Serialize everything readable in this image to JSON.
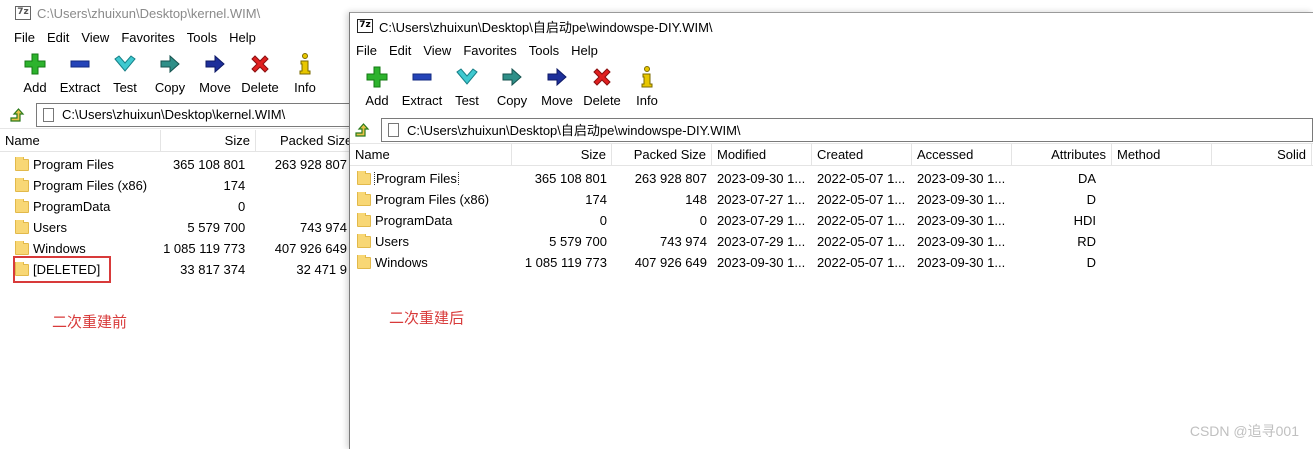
{
  "left_window": {
    "title": "C:\\Users\\zhuixun\\Desktop\\kernel.WIM\\",
    "menu": [
      "File",
      "Edit",
      "View",
      "Favorites",
      "Tools",
      "Help"
    ],
    "toolbar": {
      "add": "Add",
      "extract": "Extract",
      "test": "Test",
      "copy": "Copy",
      "move": "Move",
      "delete": "Delete",
      "info": "Info"
    },
    "address": "C:\\Users\\zhuixun\\Desktop\\kernel.WIM\\",
    "columns": {
      "name": "Name",
      "size": "Size",
      "packed_size": "Packed Size"
    },
    "rows": [
      {
        "name": "Program Files",
        "size": "365 108 801",
        "packed": "263 928 807"
      },
      {
        "name": "Program Files (x86)",
        "size": "174",
        "packed": ""
      },
      {
        "name": "ProgramData",
        "size": "0",
        "packed": ""
      },
      {
        "name": "Users",
        "size": "5 579 700",
        "packed": "743 974"
      },
      {
        "name": "Windows",
        "size": "1 085 119 773",
        "packed": "407 926 649"
      },
      {
        "name": "[DELETED]",
        "size": "33 817 374",
        "packed": "32 471 9"
      }
    ],
    "annotation": "二次重建前"
  },
  "right_window": {
    "title": "C:\\Users\\zhuixun\\Desktop\\自启动pe\\windowspe-DIY.WIM\\",
    "menu": [
      "File",
      "Edit",
      "View",
      "Favorites",
      "Tools",
      "Help"
    ],
    "toolbar": {
      "add": "Add",
      "extract": "Extract",
      "test": "Test",
      "copy": "Copy",
      "move": "Move",
      "delete": "Delete",
      "info": "Info"
    },
    "address": "C:\\Users\\zhuixun\\Desktop\\自启动pe\\windowspe-DIY.WIM\\",
    "columns": {
      "name": "Name",
      "size": "Size",
      "packed_size": "Packed Size",
      "modified": "Modified",
      "created": "Created",
      "accessed": "Accessed",
      "attributes": "Attributes",
      "method": "Method",
      "solid": "Solid"
    },
    "rows": [
      {
        "name": "Program Files",
        "size": "365 108 801",
        "packed": "263 928 807",
        "modified": "2023-09-30 1...",
        "created": "2022-05-07 1...",
        "accessed": "2023-09-30 1...",
        "attributes": "DA"
      },
      {
        "name": "Program Files (x86)",
        "size": "174",
        "packed": "148",
        "modified": "2023-07-27 1...",
        "created": "2022-05-07 1...",
        "accessed": "2023-09-30 1...",
        "attributes": "D"
      },
      {
        "name": "ProgramData",
        "size": "0",
        "packed": "0",
        "modified": "2023-07-29 1...",
        "created": "2022-05-07 1...",
        "accessed": "2023-09-30 1...",
        "attributes": "HDI"
      },
      {
        "name": "Users",
        "size": "5 579 700",
        "packed": "743 974",
        "modified": "2023-07-29 1...",
        "created": "2022-05-07 1...",
        "accessed": "2023-09-30 1...",
        "attributes": "RD"
      },
      {
        "name": "Windows",
        "size": "1 085 119 773",
        "packed": "407 926 649",
        "modified": "2023-09-30 1...",
        "created": "2022-05-07 1...",
        "accessed": "2023-09-30 1...",
        "attributes": "D"
      }
    ],
    "annotation": "二次重建后"
  },
  "watermark": "CSDN @追寻001",
  "colors": {
    "annotation": "#d83a3a",
    "folder": "#f8d775"
  }
}
